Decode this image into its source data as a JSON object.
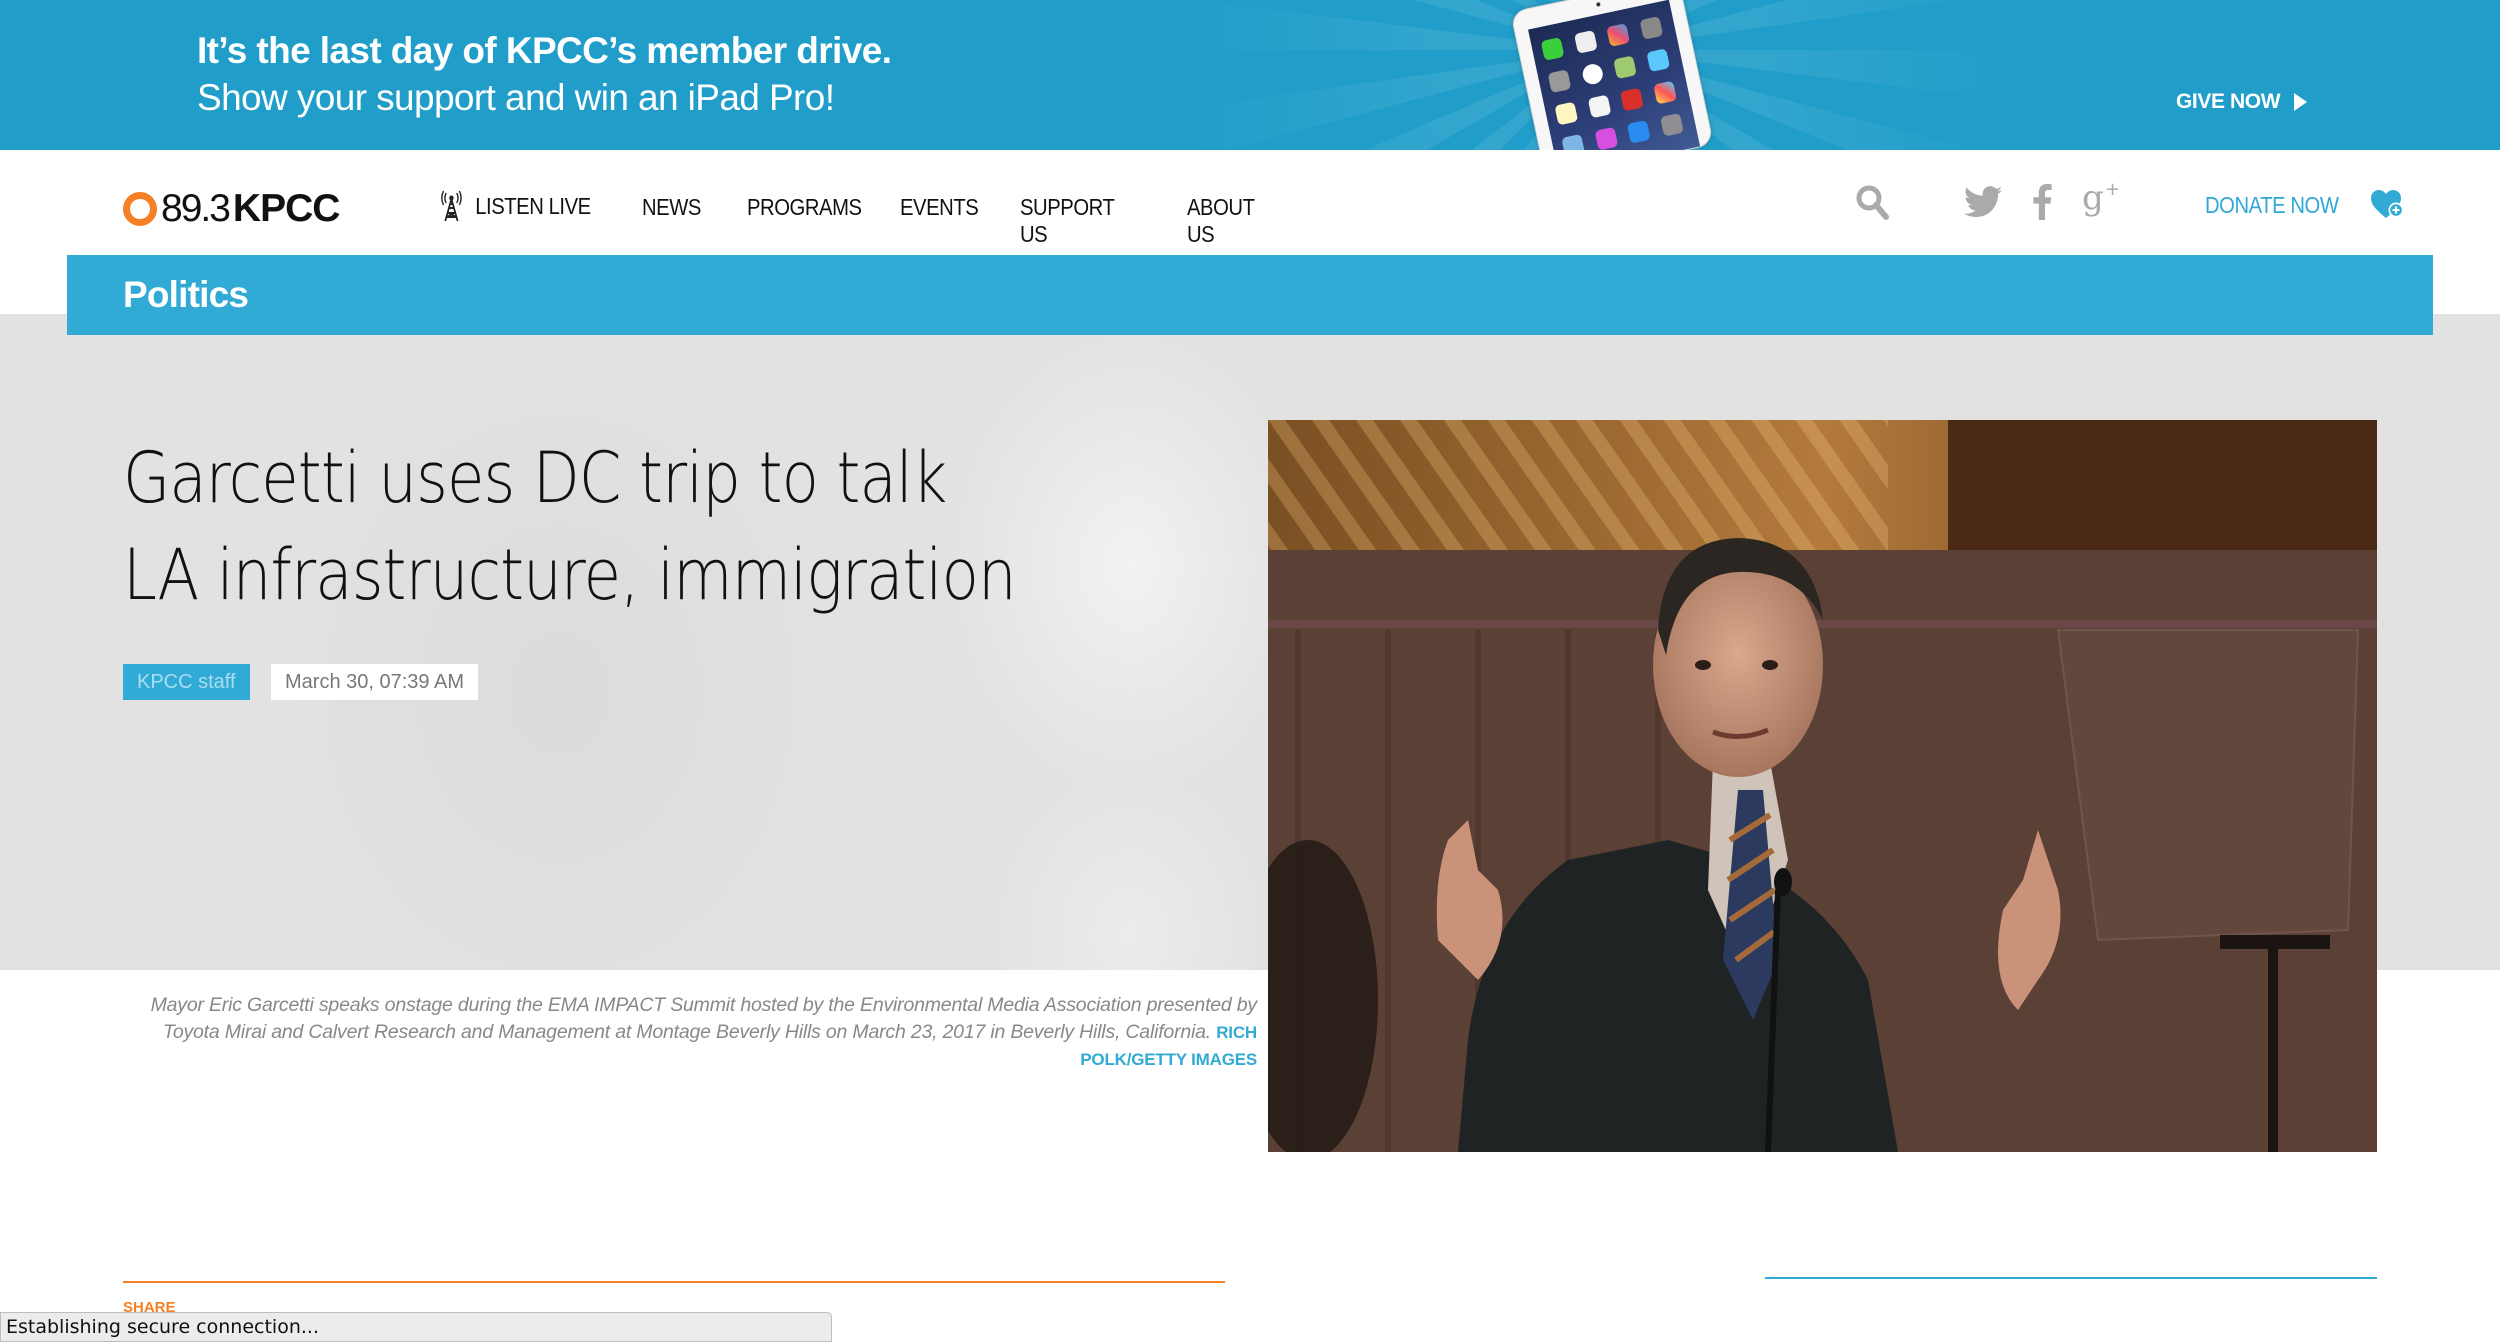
{
  "promo": {
    "headline": "It’s the last day of KPCC’s member drive.",
    "subline": "Show your support and win an iPad Pro!",
    "cta_label": "GIVE NOW",
    "background_color": "#209ec9"
  },
  "header": {
    "logo": {
      "frequency": "89.3",
      "callsign": "KPCC",
      "ring_color": "#f58026"
    },
    "nav": [
      {
        "label": "LISTEN LIVE",
        "icon": "radio-tower-icon"
      },
      {
        "label": "NEWS"
      },
      {
        "label": "PROGRAMS"
      },
      {
        "label": "EVENTS"
      },
      {
        "label": "SUPPORT US"
      },
      {
        "label": "ABOUT US"
      }
    ],
    "icons": [
      "search-icon",
      "twitter-icon",
      "facebook-icon",
      "google-plus-icon"
    ],
    "donate_label": "DONATE NOW",
    "donate_icon": "heart-plus-icon",
    "accent_color": "#31aad5"
  },
  "section": {
    "title": "Politics"
  },
  "article": {
    "headline_lines": [
      "Garcetti uses DC trip to talk",
      "LA infrastructure, immigration"
    ],
    "byline": "KPCC staff",
    "date": "March 30, 07:39 AM",
    "caption": "Mayor Eric Garcetti speaks onstage during the EMA IMPACT Summit hosted by the Environmental Media Association presented by Toyota Mirai and Calvert Research and Management at Montage Beverly Hills on March 23, 2017 in Beverly Hills, California.",
    "photo_credit": "RICH POLK/GETTY IMAGES",
    "photo_alt": "Mayor Eric Garcetti speaking onstage"
  },
  "share": {
    "label": "SHARE",
    "rule_color": "#f58026"
  },
  "browser_status": {
    "text": "Establishing secure connection..."
  }
}
